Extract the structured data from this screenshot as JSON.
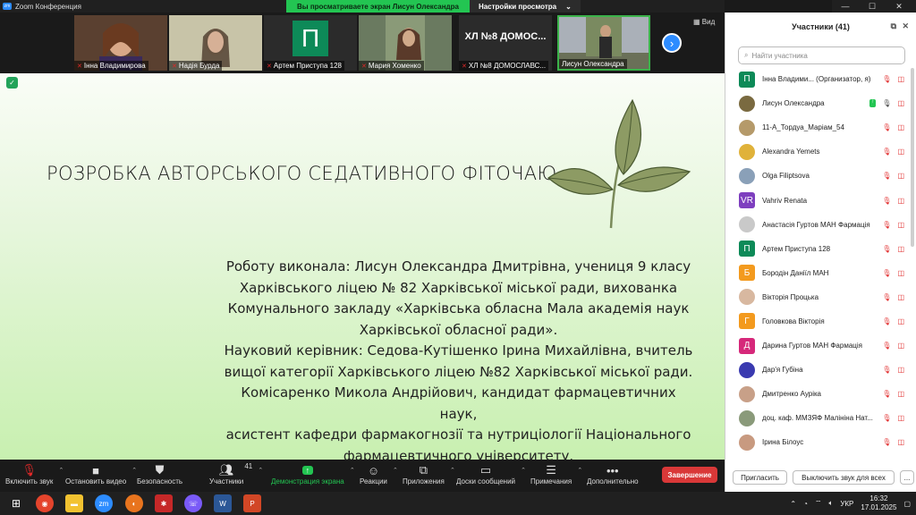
{
  "window": {
    "title": "Zoom Конференция",
    "app_icon": "zoom",
    "viewing_banner": "Вы просматриваете экран Лисун Олександра",
    "view_settings_label": "Настройки просмотра",
    "view_label": "Вид"
  },
  "gallery": [
    {
      "name": "Інна Владимирова",
      "type": "video"
    },
    {
      "name": "Надія Бурда",
      "type": "video"
    },
    {
      "name": "Артем Приступа 128",
      "type": "avatar",
      "initial": "П"
    },
    {
      "name": "Мария Хоменко",
      "type": "video"
    },
    {
      "name": "ХЛ №8 ДОМОСЛАВС...",
      "type": "text",
      "text": "ХЛ №8 ДОМОС..."
    },
    {
      "name": "Лисун Олександра",
      "type": "video",
      "active": true
    }
  ],
  "slide": {
    "title": "РОЗРОБКА АВТОРСЬКОГО СЕДАТИВНОГО ФІТОЧАЮ",
    "body": [
      "Роботу виконала: Лисун Олександра Дмитрівна, учениця 9 класу",
      "Харківського ліцею № 82 Харківської міської ради, вихованка",
      "Комунального закладу «Харківська обласна Мала академія наук",
      "Харківської обласної ради».",
      "Науковий керівник: Седова-Кутішенко Ірина Михайлівна, вчитель",
      "вищої категорії Харківського ліцею №82 Харківської міської ради.",
      "Комісаренко Микола Андрійович, кандидат фармацевтичних наук,",
      "асистент кафедри фармакогнозії та нутриціології Національного",
      "фармацевтичного університету."
    ]
  },
  "toolbar": {
    "mute": "Включить звук",
    "video": "Остановить видео",
    "security": "Безопасность",
    "participants": "Участники",
    "participants_count": "41",
    "share": "Демонстрация экрана",
    "reactions": "Реакции",
    "apps": "Приложения",
    "whiteboards": "Доски сообщений",
    "notes": "Примечания",
    "more": "Дополнительно",
    "end": "Завершение"
  },
  "panel": {
    "title": "Участники (41)",
    "search_placeholder": "Найти участника",
    "participants": [
      {
        "name": "Інна Владими...  (Организатор, я)",
        "avatar": "П",
        "color": "#0d8a58",
        "photo": false
      },
      {
        "name": "Лисун Олександра",
        "avatar": "",
        "color": "#7a6a40",
        "photo": true,
        "sharing": true
      },
      {
        "name": "11-А_Тордуа_Маріам_54",
        "avatar": "",
        "color": "#b59a6a",
        "photo": true
      },
      {
        "name": "Alexandra Yemets",
        "avatar": "",
        "color": "#e0b23a",
        "photo": true
      },
      {
        "name": "Olga Filiptsova",
        "avatar": "",
        "color": "#8aa0b8",
        "photo": true
      },
      {
        "name": "Vahriv Renata",
        "avatar": "VR",
        "color": "#7e3fbf",
        "photo": false
      },
      {
        "name": "Анастасія Гуртов МАН Фармація",
        "avatar": "",
        "color": "#c9c9c9",
        "photo": true
      },
      {
        "name": "Артем Приступа 128",
        "avatar": "П",
        "color": "#0d8a58",
        "photo": false
      },
      {
        "name": "Бородін Даніїл МАН",
        "avatar": "Б",
        "color": "#f39a1e",
        "photo": false
      },
      {
        "name": "Вікторія Процька",
        "avatar": "",
        "color": "#d8b8a0",
        "photo": true
      },
      {
        "name": "Головкова Вікторія",
        "avatar": "Г",
        "color": "#f39a1e",
        "photo": false
      },
      {
        "name": "Дарина Гуртов МАН Фармація",
        "avatar": "Д",
        "color": "#d6287a",
        "photo": false
      },
      {
        "name": "Дар'я Губіна",
        "avatar": "",
        "color": "#3a3ab0",
        "photo": true
      },
      {
        "name": "Дмитренко Аурікa",
        "avatar": "",
        "color": "#c8a088",
        "photo": true
      },
      {
        "name": "доц. каф. ММЗЯФ Малініна Нат...",
        "avatar": "",
        "color": "#8a9a7a",
        "photo": true
      },
      {
        "name": "Ірина Білоус",
        "avatar": "",
        "color": "#c89a80",
        "photo": true
      }
    ],
    "invite": "Пригласить",
    "unmute_all": "Выключить звук для всех",
    "more": "..."
  },
  "taskbar": {
    "language": "УКР",
    "time": "16:32",
    "date": "17.01.2025"
  }
}
